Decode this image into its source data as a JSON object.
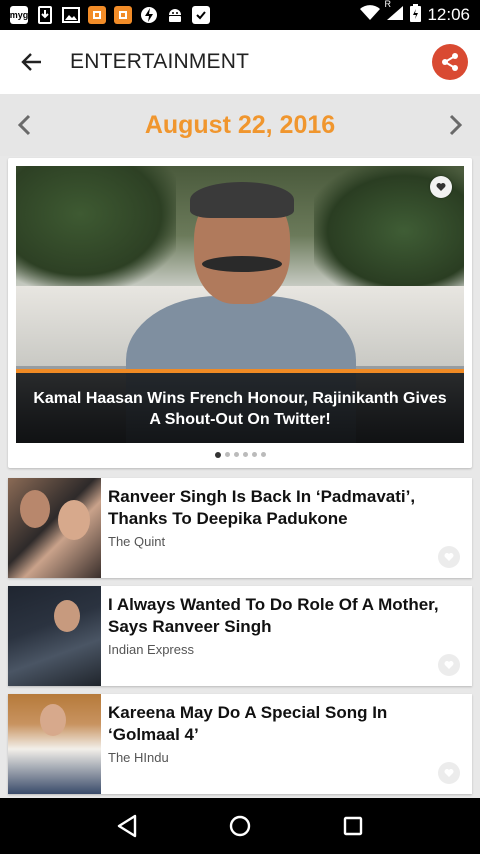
{
  "status_bar": {
    "time": "12:06",
    "left_icons": [
      "myg-icon",
      "download-icon",
      "gallery-icon",
      "app-orange-icon",
      "app-orange-icon",
      "lightning-icon",
      "android-icon",
      "clipboard-check-icon"
    ],
    "right_icons": [
      "wifi-icon",
      "signal-icon",
      "battery-icon"
    ],
    "myg_label": "myg",
    "roaming_label": "R"
  },
  "app_bar": {
    "back_icon": "arrow-left-icon",
    "title": "ENTERTAINMENT",
    "share_icon": "share-icon",
    "share_color": "#d94a32"
  },
  "date_bar": {
    "date": "August 22, 2016",
    "accent": "#f0962e",
    "prev_icon": "chevron-left-icon",
    "next_icon": "chevron-right-icon"
  },
  "featured": {
    "caption": "Kamal Haasan Wins French Honour, Rajinikanth Gives A Shout-Out On Twitter!",
    "fav_icon": "heart-icon",
    "dots_total": 6,
    "dots_active_index": 0
  },
  "news": [
    {
      "title": "Ranveer Singh Is Back In ‘Padmavati’, Thanks To Deepika Padukone",
      "source": "The Quint",
      "fav_icon": "heart-icon"
    },
    {
      "title": "I Always Wanted To Do Role Of A Mother, Says Ranveer Singh",
      "source": "Indian Express",
      "fav_icon": "heart-icon"
    },
    {
      "title": "Kareena May Do A Special Song In ‘Golmaal 4’",
      "source": "The HIndu",
      "fav_icon": "heart-icon"
    }
  ],
  "nav_bar": {
    "back_icon": "triangle-back-icon",
    "home_icon": "circle-home-icon",
    "recents_icon": "square-recents-icon"
  }
}
